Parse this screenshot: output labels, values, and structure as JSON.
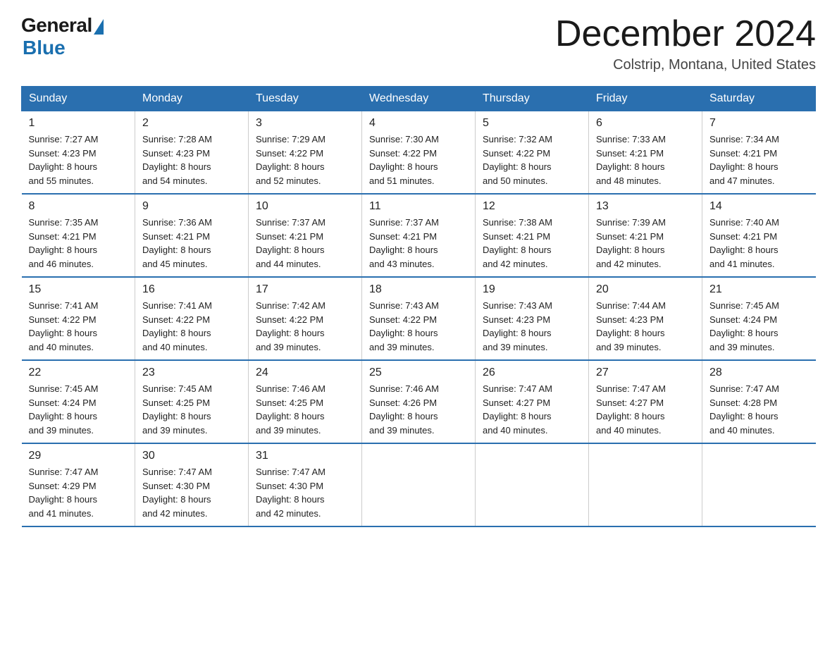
{
  "logo": {
    "general": "General",
    "blue": "Blue"
  },
  "title": "December 2024",
  "location": "Colstrip, Montana, United States",
  "days_of_week": [
    "Sunday",
    "Monday",
    "Tuesday",
    "Wednesday",
    "Thursday",
    "Friday",
    "Saturday"
  ],
  "weeks": [
    [
      {
        "day": "1",
        "sunrise": "7:27 AM",
        "sunset": "4:23 PM",
        "daylight": "8 hours and 55 minutes."
      },
      {
        "day": "2",
        "sunrise": "7:28 AM",
        "sunset": "4:23 PM",
        "daylight": "8 hours and 54 minutes."
      },
      {
        "day": "3",
        "sunrise": "7:29 AM",
        "sunset": "4:22 PM",
        "daylight": "8 hours and 52 minutes."
      },
      {
        "day": "4",
        "sunrise": "7:30 AM",
        "sunset": "4:22 PM",
        "daylight": "8 hours and 51 minutes."
      },
      {
        "day": "5",
        "sunrise": "7:32 AM",
        "sunset": "4:22 PM",
        "daylight": "8 hours and 50 minutes."
      },
      {
        "day": "6",
        "sunrise": "7:33 AM",
        "sunset": "4:21 PM",
        "daylight": "8 hours and 48 minutes."
      },
      {
        "day": "7",
        "sunrise": "7:34 AM",
        "sunset": "4:21 PM",
        "daylight": "8 hours and 47 minutes."
      }
    ],
    [
      {
        "day": "8",
        "sunrise": "7:35 AM",
        "sunset": "4:21 PM",
        "daylight": "8 hours and 46 minutes."
      },
      {
        "day": "9",
        "sunrise": "7:36 AM",
        "sunset": "4:21 PM",
        "daylight": "8 hours and 45 minutes."
      },
      {
        "day": "10",
        "sunrise": "7:37 AM",
        "sunset": "4:21 PM",
        "daylight": "8 hours and 44 minutes."
      },
      {
        "day": "11",
        "sunrise": "7:37 AM",
        "sunset": "4:21 PM",
        "daylight": "8 hours and 43 minutes."
      },
      {
        "day": "12",
        "sunrise": "7:38 AM",
        "sunset": "4:21 PM",
        "daylight": "8 hours and 42 minutes."
      },
      {
        "day": "13",
        "sunrise": "7:39 AM",
        "sunset": "4:21 PM",
        "daylight": "8 hours and 42 minutes."
      },
      {
        "day": "14",
        "sunrise": "7:40 AM",
        "sunset": "4:21 PM",
        "daylight": "8 hours and 41 minutes."
      }
    ],
    [
      {
        "day": "15",
        "sunrise": "7:41 AM",
        "sunset": "4:22 PM",
        "daylight": "8 hours and 40 minutes."
      },
      {
        "day": "16",
        "sunrise": "7:41 AM",
        "sunset": "4:22 PM",
        "daylight": "8 hours and 40 minutes."
      },
      {
        "day": "17",
        "sunrise": "7:42 AM",
        "sunset": "4:22 PM",
        "daylight": "8 hours and 39 minutes."
      },
      {
        "day": "18",
        "sunrise": "7:43 AM",
        "sunset": "4:22 PM",
        "daylight": "8 hours and 39 minutes."
      },
      {
        "day": "19",
        "sunrise": "7:43 AM",
        "sunset": "4:23 PM",
        "daylight": "8 hours and 39 minutes."
      },
      {
        "day": "20",
        "sunrise": "7:44 AM",
        "sunset": "4:23 PM",
        "daylight": "8 hours and 39 minutes."
      },
      {
        "day": "21",
        "sunrise": "7:45 AM",
        "sunset": "4:24 PM",
        "daylight": "8 hours and 39 minutes."
      }
    ],
    [
      {
        "day": "22",
        "sunrise": "7:45 AM",
        "sunset": "4:24 PM",
        "daylight": "8 hours and 39 minutes."
      },
      {
        "day": "23",
        "sunrise": "7:45 AM",
        "sunset": "4:25 PM",
        "daylight": "8 hours and 39 minutes."
      },
      {
        "day": "24",
        "sunrise": "7:46 AM",
        "sunset": "4:25 PM",
        "daylight": "8 hours and 39 minutes."
      },
      {
        "day": "25",
        "sunrise": "7:46 AM",
        "sunset": "4:26 PM",
        "daylight": "8 hours and 39 minutes."
      },
      {
        "day": "26",
        "sunrise": "7:47 AM",
        "sunset": "4:27 PM",
        "daylight": "8 hours and 40 minutes."
      },
      {
        "day": "27",
        "sunrise": "7:47 AM",
        "sunset": "4:27 PM",
        "daylight": "8 hours and 40 minutes."
      },
      {
        "day": "28",
        "sunrise": "7:47 AM",
        "sunset": "4:28 PM",
        "daylight": "8 hours and 40 minutes."
      }
    ],
    [
      {
        "day": "29",
        "sunrise": "7:47 AM",
        "sunset": "4:29 PM",
        "daylight": "8 hours and 41 minutes."
      },
      {
        "day": "30",
        "sunrise": "7:47 AM",
        "sunset": "4:30 PM",
        "daylight": "8 hours and 42 minutes."
      },
      {
        "day": "31",
        "sunrise": "7:47 AM",
        "sunset": "4:30 PM",
        "daylight": "8 hours and 42 minutes."
      },
      null,
      null,
      null,
      null
    ]
  ],
  "labels": {
    "sunrise": "Sunrise:",
    "sunset": "Sunset:",
    "daylight": "Daylight:"
  }
}
